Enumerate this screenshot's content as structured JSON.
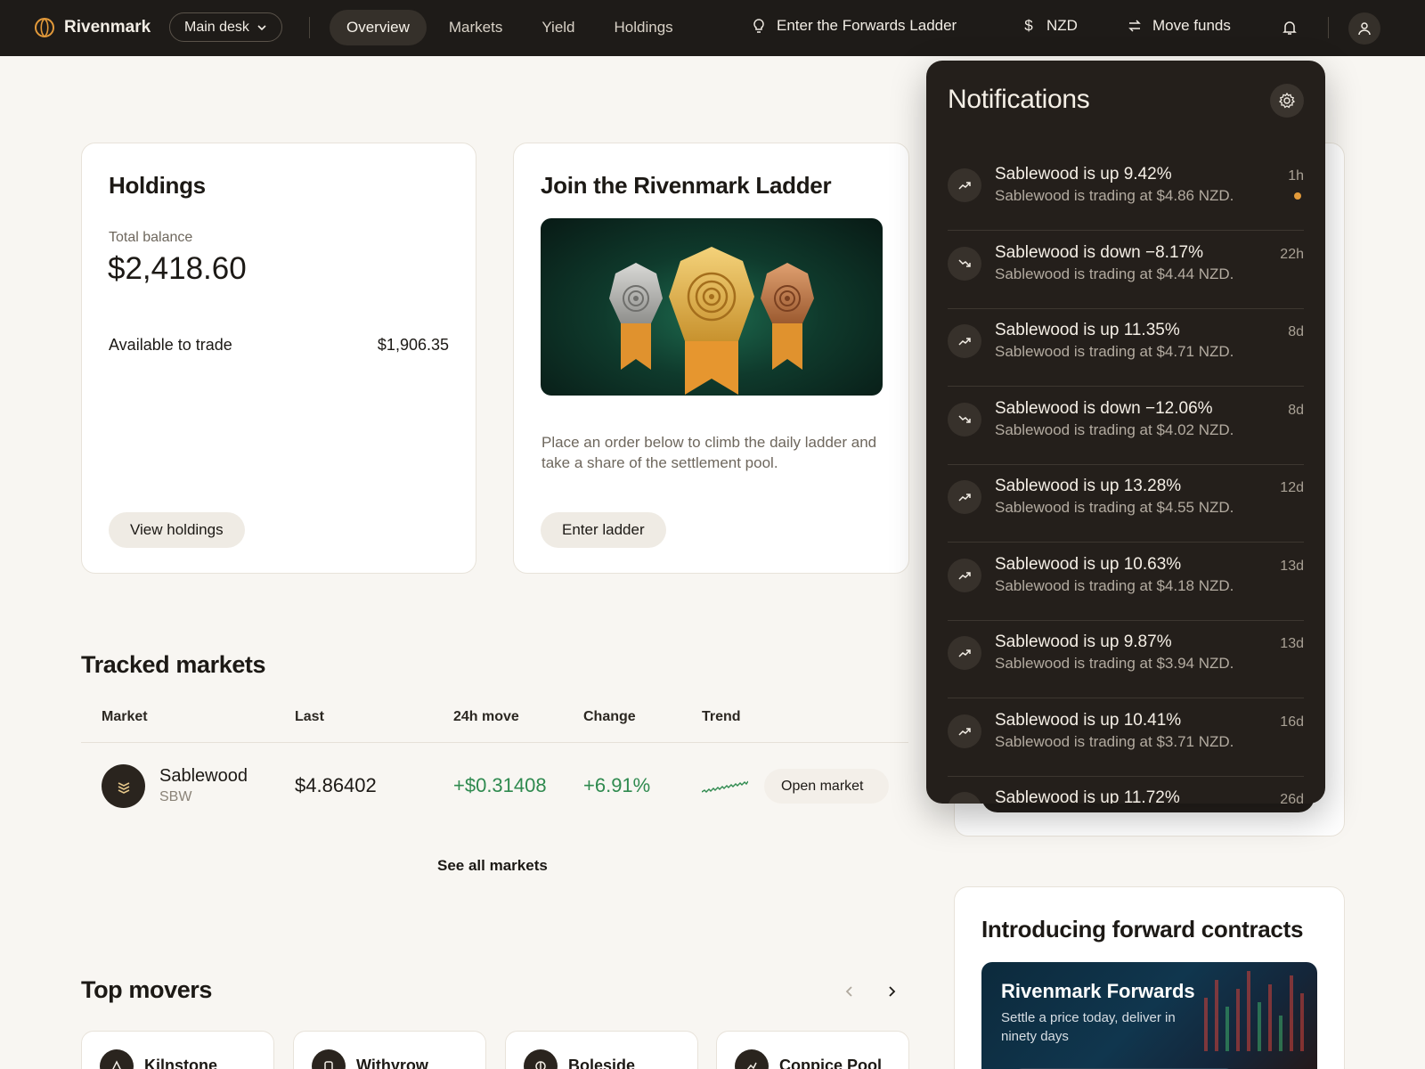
{
  "topbar": {
    "brand": "Rivenmark",
    "desk": "Main desk",
    "nav": [
      "Overview",
      "Markets",
      "Yield",
      "Holdings"
    ],
    "forwards": "Enter the Forwards Ladder",
    "currency": "NZD",
    "move_funds": "Move funds"
  },
  "holdings": {
    "title": "Holdings",
    "balance_label": "Total balance",
    "balance": "$2,418.60",
    "available_label": "Available to trade",
    "available": "$1,906.35",
    "button": "View holdings"
  },
  "ladder": {
    "title": "Join the Rivenmark Ladder",
    "description": "Place an order below to climb the daily ladder and take a share of the settlement pool.",
    "button": "Enter ladder"
  },
  "tracked": {
    "title": "Tracked markets",
    "headers": [
      "Market",
      "Last",
      "24h move",
      "Change",
      "Trend"
    ],
    "row": {
      "name": "Sablewood",
      "ticker": "SBW",
      "last": "$4.86402",
      "move": "+$0.31408",
      "change": "+6.91%",
      "action": "Open market"
    },
    "see_all": "See all markets"
  },
  "movers": {
    "title": "Top movers",
    "items": [
      "Kilnstone",
      "Withyrow",
      "Boleside",
      "Coppice Pool"
    ]
  },
  "forward": {
    "title": "Introducing forward contracts",
    "banner_title": "Rivenmark Forwards",
    "banner_sub": "Settle a price today, deliver in ninety days"
  },
  "notifications": {
    "title": "Notifications",
    "items": [
      {
        "title": "Sablewood is up 9.42%",
        "sub": "Sablewood is trading at $4.86 NZD.",
        "time": "1h",
        "dir": "up",
        "unread": true
      },
      {
        "title": "Sablewood is down −8.17%",
        "sub": "Sablewood is trading at $4.44 NZD.",
        "time": "22h",
        "dir": "down"
      },
      {
        "title": "Sablewood is up 11.35%",
        "sub": "Sablewood is trading at $4.71 NZD.",
        "time": "8d",
        "dir": "up"
      },
      {
        "title": "Sablewood is down −12.06%",
        "sub": "Sablewood is trading at $4.02 NZD.",
        "time": "8d",
        "dir": "down"
      },
      {
        "title": "Sablewood is up 13.28%",
        "sub": "Sablewood is trading at $4.55 NZD.",
        "time": "12d",
        "dir": "up"
      },
      {
        "title": "Sablewood is up 10.63%",
        "sub": "Sablewood is trading at $4.18 NZD.",
        "time": "13d",
        "dir": "up"
      },
      {
        "title": "Sablewood is up 9.87%",
        "sub": "Sablewood is trading at $3.94 NZD.",
        "time": "13d",
        "dir": "up"
      },
      {
        "title": "Sablewood is up 10.41%",
        "sub": "Sablewood is trading at $3.71 NZD.",
        "time": "16d",
        "dir": "up"
      },
      {
        "title": "Sablewood is up 11.72%",
        "sub": "",
        "time": "26d",
        "dir": "up"
      }
    ]
  },
  "colors": {
    "topbar": "#1e1b18",
    "accent": "#e39a3a",
    "positive": "#2f8a4f",
    "panel": "#241f1b"
  }
}
